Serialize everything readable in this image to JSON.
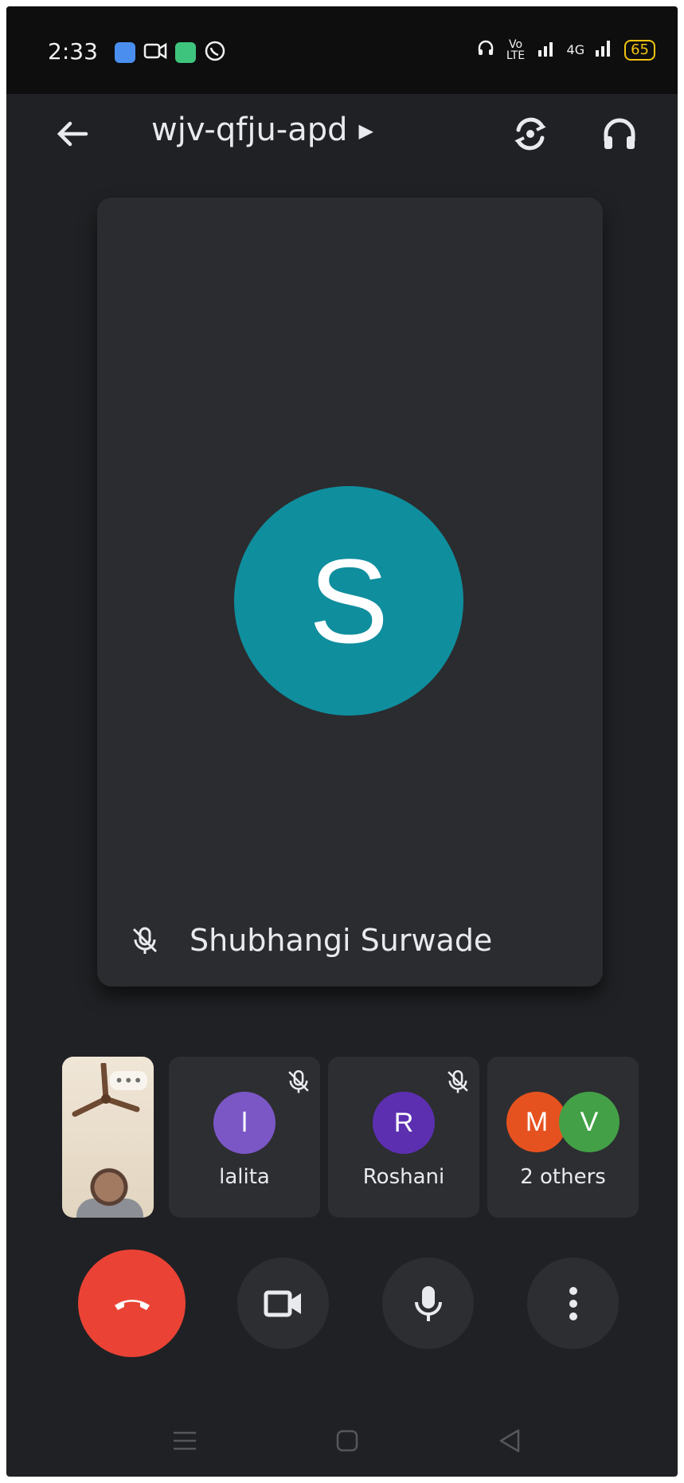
{
  "status": {
    "time": "2:33",
    "signal_labels": {
      "volte": "Vo LTE",
      "network": "4G"
    },
    "battery": "65",
    "left_icons": [
      "app-blue-icon",
      "video-icon",
      "app-green-icon",
      "whatsapp-icon"
    ]
  },
  "header": {
    "meeting_code": "wjv-qfju-apd"
  },
  "main_participant": {
    "initial": "S",
    "name": "Shubhangi Surwade",
    "avatar_color": "#0f8e9e"
  },
  "participants": [
    {
      "initial": "l",
      "name": "lalita",
      "color": "#7b57c6"
    },
    {
      "initial": "R",
      "name": "Roshani",
      "color": "#5c2fb0"
    }
  ],
  "others": {
    "label": "2 others",
    "avatars": [
      {
        "initial": "M",
        "color": "#e6521f"
      },
      {
        "initial": "V",
        "color": "#43a047"
      }
    ]
  },
  "self_view": {
    "menu_label": "•••"
  },
  "colors": {
    "end_call": "#ea4335",
    "background": "#202124",
    "tile": "#2b2c2f"
  }
}
